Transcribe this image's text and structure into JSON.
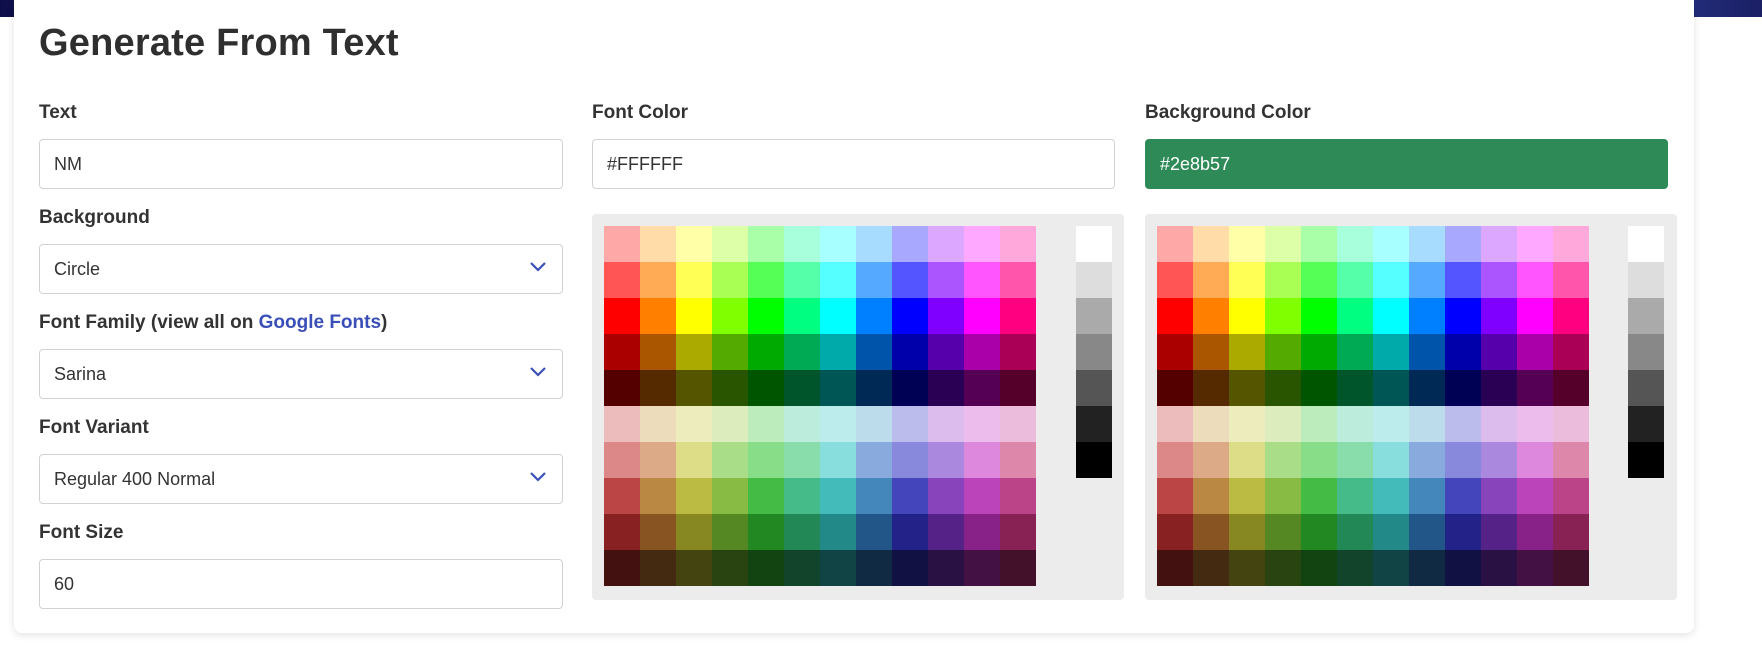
{
  "page": {
    "title": "Generate From Text"
  },
  "form": {
    "text": {
      "label": "Text",
      "value": "NM"
    },
    "background": {
      "label": "Background",
      "value": "Circle"
    },
    "font_family": {
      "label_prefix": "Font Family (view all on ",
      "link_text": "Google Fonts",
      "label_suffix": ")",
      "value": "Sarina"
    },
    "font_variant": {
      "label": "Font Variant",
      "value": "Regular 400 Normal"
    },
    "font_size": {
      "label": "Font Size",
      "value": "60"
    },
    "font_color": {
      "label": "Font Color",
      "value": "#FFFFFF"
    },
    "background_color": {
      "label": "Background Color",
      "value": "#2e8b57"
    }
  },
  "icons": {
    "select_chevron": "chevron-down-icon"
  },
  "colors": {
    "accent_link": "#3a4fb8",
    "background_color_field": "#2e8b57",
    "palette_rows": [
      [
        "#ffa8a8",
        "#ffdca8",
        "#ffffa8",
        "#dcffa8",
        "#a8ffa8",
        "#a8ffdc",
        "#a8ffff",
        "#a8dcff",
        "#a8a8ff",
        "#dca8ff",
        "#ffa8ff",
        "#ffa8dc"
      ],
      [
        "#ff5555",
        "#ffaa55",
        "#ffff55",
        "#aaff55",
        "#55ff55",
        "#55ffaa",
        "#55ffff",
        "#55aaff",
        "#5555ff",
        "#aa55ff",
        "#ff55ff",
        "#ff55aa"
      ],
      [
        "#ff0000",
        "#ff8000",
        "#ffff00",
        "#80ff00",
        "#00ff00",
        "#00ff80",
        "#00ffff",
        "#0080ff",
        "#0000ff",
        "#8000ff",
        "#ff00ff",
        "#ff0080"
      ],
      [
        "#aa0000",
        "#aa5500",
        "#aaaa00",
        "#55aa00",
        "#00aa00",
        "#00aa55",
        "#00aaaa",
        "#0055aa",
        "#0000aa",
        "#5500aa",
        "#aa00aa",
        "#aa0055"
      ],
      [
        "#550000",
        "#552a00",
        "#555500",
        "#2a5500",
        "#005500",
        "#00552a",
        "#005555",
        "#002a55",
        "#000055",
        "#2a0055",
        "#550055",
        "#55002a"
      ],
      [
        "#ecbcbc",
        "#ecdcbc",
        "#ececbc",
        "#dcecbc",
        "#bcecbc",
        "#bcecdc",
        "#bcecec",
        "#bcdcec",
        "#bcbcec",
        "#dcbcec",
        "#ecbcec",
        "#ecbcdc"
      ],
      [
        "#dd8888",
        "#ddaa88",
        "#dddd88",
        "#aadd88",
        "#88dd88",
        "#88ddaa",
        "#88dddd",
        "#88aadd",
        "#8888dd",
        "#aa88dd",
        "#dd88dd",
        "#dd88aa"
      ],
      [
        "#bb4444",
        "#bb8844",
        "#bbbb44",
        "#88bb44",
        "#44bb44",
        "#44bb88",
        "#44bbbb",
        "#4488bb",
        "#4444bb",
        "#8844bb",
        "#bb44bb",
        "#bb4488"
      ],
      [
        "#882222",
        "#885522",
        "#888822",
        "#558822",
        "#228822",
        "#228855",
        "#228888",
        "#225588",
        "#222288",
        "#552288",
        "#882288",
        "#882255"
      ],
      [
        "#441111",
        "#442a11",
        "#444411",
        "#2a4411",
        "#114411",
        "#11442a",
        "#114444",
        "#112a44",
        "#111144",
        "#2a1144",
        "#441144",
        "#44112a"
      ]
    ],
    "grayscale": [
      "#ffffff",
      "#dddddd",
      "#aaaaaa",
      "#888888",
      "#555555",
      "#222222",
      "#000000"
    ]
  }
}
